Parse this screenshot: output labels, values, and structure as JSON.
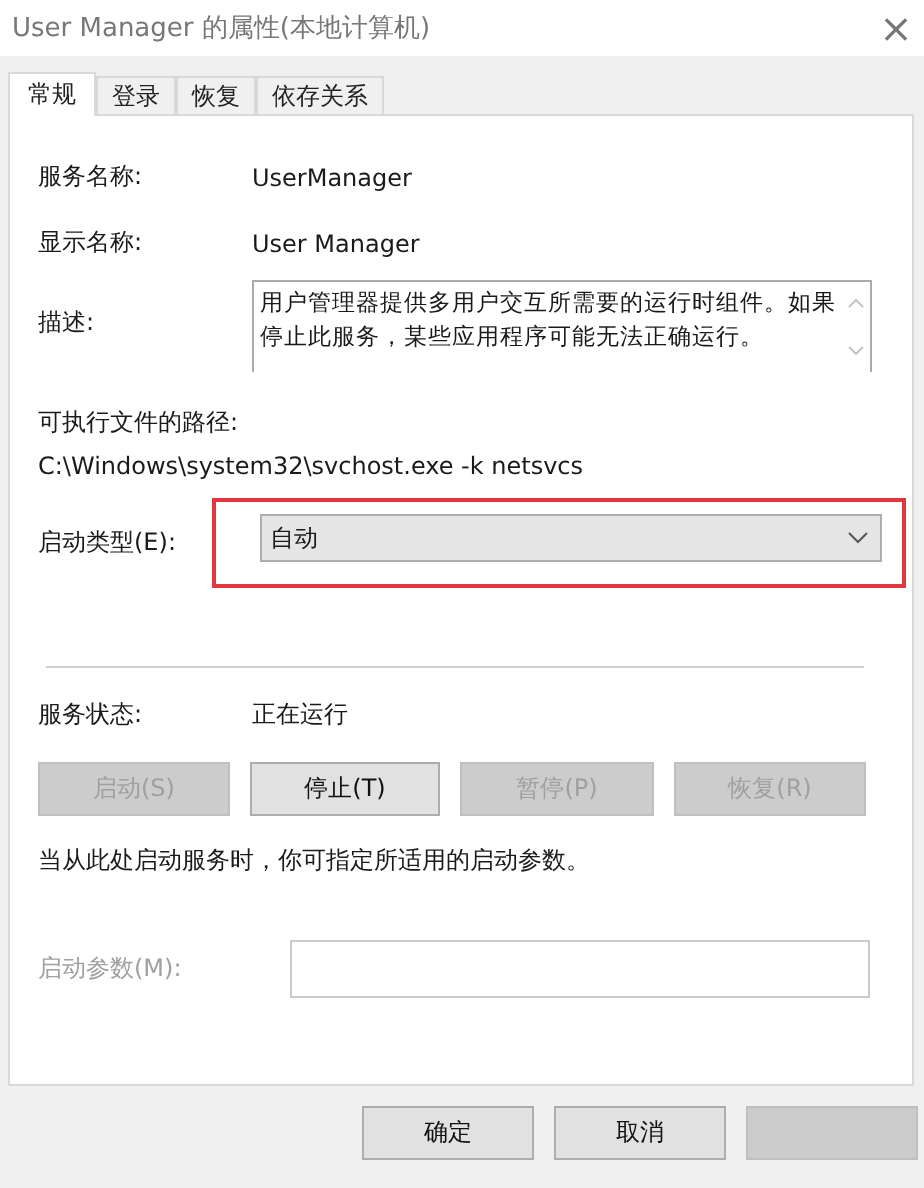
{
  "window": {
    "title": "User Manager 的属性(本地计算机)",
    "close": "×"
  },
  "tabs": [
    {
      "label": "常规",
      "selected": true
    },
    {
      "label": "登录",
      "selected": false
    },
    {
      "label": "恢复",
      "selected": false
    },
    {
      "label": "依存关系",
      "selected": false
    }
  ],
  "service_name": {
    "label": "服务名称:",
    "value": "UserManager"
  },
  "display_name": {
    "label": "显示名称:",
    "value": "User Manager"
  },
  "description": {
    "label": "描述:",
    "value": "用户管理器提供多用户交互所需要的运行时组件。如果停止此服务，某些应用程序可能无法正确运行。"
  },
  "executable_path": {
    "label": "可执行文件的路径:",
    "value": "C:\\Windows\\system32\\svchost.exe -k netsvcs"
  },
  "startup_type": {
    "label": "启动类型(E):",
    "value": "自动",
    "highlighted": true
  },
  "service_status": {
    "label": "服务状态:",
    "value": "正在运行"
  },
  "service_buttons": [
    {
      "label": "启动(S)",
      "disabled": true
    },
    {
      "label": "停止(T)",
      "disabled": false
    },
    {
      "label": "暂停(P)",
      "disabled": true
    },
    {
      "label": "恢复(R)",
      "disabled": true
    }
  ],
  "start_hint": "当从此处启动服务时，你可指定所适用的启动参数。",
  "start_parameters": {
    "label": "启动参数(M):",
    "disabled": true
  },
  "dialog_buttons": [
    {
      "label": "确定",
      "disabled": false
    },
    {
      "label": "取消",
      "disabled": false
    },
    {
      "disabled": true
    }
  ]
}
